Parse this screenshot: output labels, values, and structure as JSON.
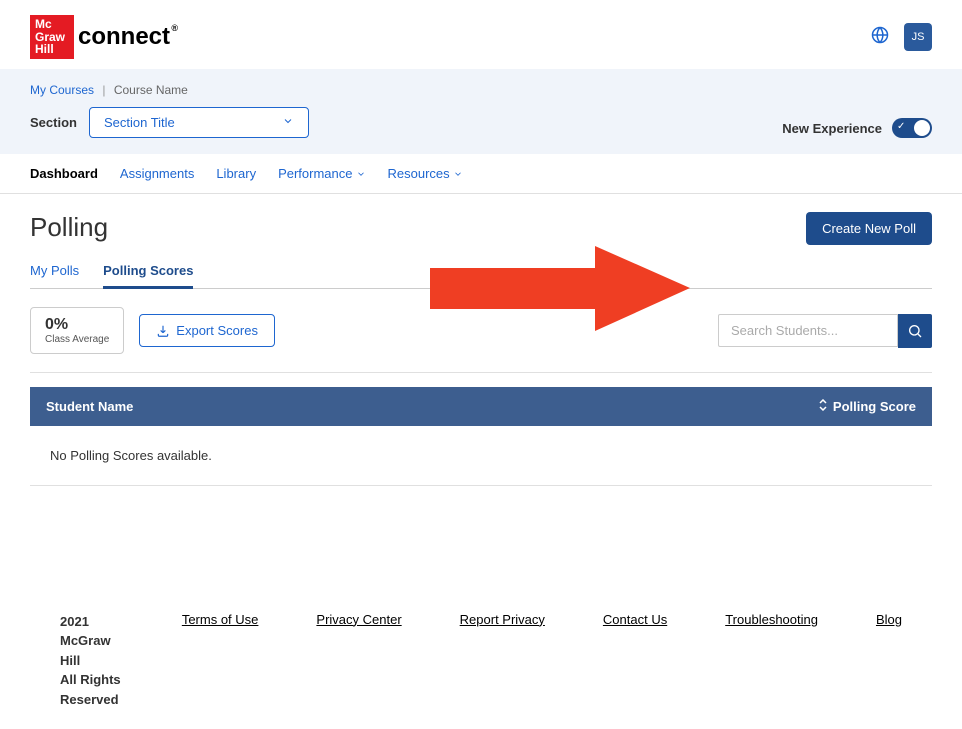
{
  "header": {
    "brand_box": [
      "Mc",
      "Graw",
      "Hill"
    ],
    "brand_name": "connect",
    "avatar_initials": "JS"
  },
  "breadcrumb": {
    "my_courses": "My Courses",
    "course_name": "Course Name",
    "section_label": "Section",
    "section_value": "Section Title",
    "new_experience": "New Experience"
  },
  "nav": {
    "dashboard": "Dashboard",
    "assignments": "Assignments",
    "library": "Library",
    "performance": "Performance",
    "resources": "Resources"
  },
  "page": {
    "title": "Polling",
    "create_poll": "Create New Poll"
  },
  "subtabs": {
    "my_polls": "My Polls",
    "polling_scores": "Polling Scores"
  },
  "scores": {
    "avg_value": "0%",
    "avg_label": "Class Average",
    "export_label": "Export Scores"
  },
  "search": {
    "placeholder": "Search Students..."
  },
  "table": {
    "col_student": "Student Name",
    "col_score": "Polling  Score",
    "empty": "No Polling Scores available."
  },
  "footer": {
    "copy_line1": "2021 McGraw Hill",
    "copy_line2": "All Rights Reserved",
    "links": {
      "terms": "Terms of Use",
      "privacy_center": "Privacy Center",
      "report_privacy": "Report Privacy",
      "contact": "Contact Us",
      "troubleshoot": "Troubleshooting",
      "blog": "Blog"
    }
  }
}
